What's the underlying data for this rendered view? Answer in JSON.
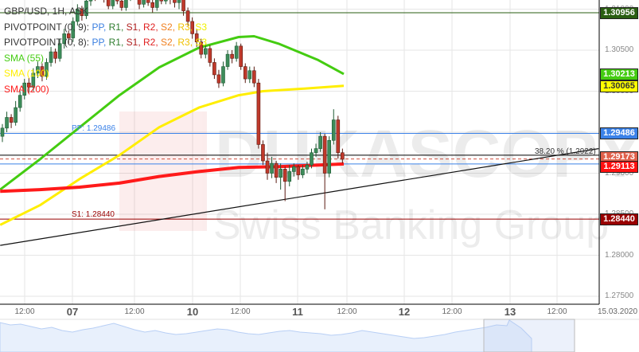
{
  "legend": {
    "symbol": "GBP/USD, 1H, ASK",
    "pivot1_prefix": "PIVOTPOINT (0, 9):",
    "pivot2_prefix": "PIVOTPOINT (0, 8):",
    "pivot_items": [
      "PP",
      "R1",
      "S1",
      "R2",
      "S2",
      "R3",
      "S3"
    ],
    "pivot_colors": [
      "#3a7fe0",
      "#2f7d2f",
      "#b22222",
      "#e02020",
      "#f08020",
      "#f0c000",
      "#f0f000"
    ],
    "sma55": "SMA (55)",
    "sma100": "SMA (100)",
    "sma200": "SMA (200)"
  },
  "line_labels": {
    "pp": "PP: 1.29486",
    "s1": "S1: 1.28440",
    "fib": "38.20 % (1.2922)"
  },
  "tags": [
    {
      "text": "1.30956",
      "bg": "#2a5e12",
      "fg": "#ffffff",
      "price": 1.30956
    },
    {
      "text": "1.30213",
      "bg": "#44cc11",
      "fg": "#ffffff",
      "price": 1.30213
    },
    {
      "text": "1.30065",
      "bg": "#ffff00",
      "fg": "#333333",
      "price": 1.30065
    },
    {
      "text": "1.29486",
      "bg": "#3b82e8",
      "fg": "#ffffff",
      "price": 1.29486
    },
    {
      "text": "1.29173",
      "bg": "#e0604a",
      "fg": "#ffffff",
      "price": 1.29173
    },
    {
      "text": "1.29113",
      "bg": "#ff1010",
      "fg": "#ffffff",
      "price": 1.29113
    },
    {
      "text": "1.28440",
      "bg": "#990000",
      "fg": "#ffffff",
      "price": 1.2844
    }
  ],
  "chart_data": {
    "type": "candlestick",
    "title": "GBP/USD, 1H, ASK",
    "ylim": [
      1.2737,
      1.3111
    ],
    "yticks": [
      "1.31000",
      "1.30500",
      "1.30000",
      "1.29500",
      "1.29000",
      "1.28500",
      "1.28000",
      "1.27500"
    ],
    "xticks": [
      {
        "label": "12:00",
        "day": false
      },
      {
        "label": "07",
        "day": true
      },
      {
        "label": "12:00",
        "day": false
      },
      {
        "label": "10",
        "day": true
      },
      {
        "label": "12:00",
        "day": false
      },
      {
        "label": "11",
        "day": true
      },
      {
        "label": "12:00",
        "day": false
      },
      {
        "label": "12",
        "day": true
      },
      {
        "label": "12:00",
        "day": false
      },
      {
        "label": "13",
        "day": true
      },
      {
        "label": "12:00",
        "day": false
      },
      {
        "label": "15.03.2020",
        "day": false
      }
    ],
    "candles": [
      [
        1.2945,
        1.296,
        1.2938,
        1.2955
      ],
      [
        1.2955,
        1.2975,
        1.295,
        1.2968
      ],
      [
        1.2968,
        1.2972,
        1.2955,
        1.2962
      ],
      [
        1.2962,
        1.2988,
        1.2958,
        1.298
      ],
      [
        1.298,
        1.3,
        1.2975,
        1.2995
      ],
      [
        1.2995,
        1.3015,
        1.299,
        1.301
      ],
      [
        1.301,
        1.3016,
        1.2998,
        1.3005
      ],
      [
        1.3005,
        1.3028,
        1.3,
        1.3022
      ],
      [
        1.3022,
        1.3036,
        1.3016,
        1.303
      ],
      [
        1.303,
        1.3034,
        1.3012,
        1.3018
      ],
      [
        1.3018,
        1.304,
        1.3014,
        1.3035
      ],
      [
        1.3035,
        1.3054,
        1.303,
        1.3048
      ],
      [
        1.3048,
        1.3052,
        1.3034,
        1.304
      ],
      [
        1.304,
        1.3064,
        1.3036,
        1.3058
      ],
      [
        1.3058,
        1.3076,
        1.3052,
        1.307
      ],
      [
        1.307,
        1.3074,
        1.3058,
        1.3065
      ],
      [
        1.3065,
        1.309,
        1.306,
        1.3085
      ],
      [
        1.3085,
        1.3106,
        1.308,
        1.31
      ],
      [
        1.31,
        1.3104,
        1.3086,
        1.3092
      ],
      [
        1.3092,
        1.3118,
        1.3088,
        1.311
      ],
      [
        1.311,
        1.313,
        1.3104,
        1.3125
      ],
      [
        1.3125,
        1.3128,
        1.311,
        1.3118
      ],
      [
        1.3118,
        1.3136,
        1.3112,
        1.313
      ],
      [
        1.313,
        1.3134,
        1.3108,
        1.3112
      ],
      [
        1.3112,
        1.312,
        1.31,
        1.3104
      ],
      [
        1.3104,
        1.3122,
        1.31,
        1.3118
      ],
      [
        1.3118,
        1.3126,
        1.3106,
        1.311
      ],
      [
        1.311,
        1.3116,
        1.3098,
        1.3102
      ],
      [
        1.3102,
        1.312,
        1.3098,
        1.3115
      ],
      [
        1.3115,
        1.313,
        1.311,
        1.3126
      ],
      [
        1.3126,
        1.313,
        1.3112,
        1.3116
      ],
      [
        1.3116,
        1.3122,
        1.31,
        1.3106
      ],
      [
        1.3106,
        1.3118,
        1.3102,
        1.3114
      ],
      [
        1.3114,
        1.3122,
        1.3104,
        1.3108
      ],
      [
        1.3108,
        1.3114,
        1.3096,
        1.3102
      ],
      [
        1.3102,
        1.312,
        1.3098,
        1.3116
      ],
      [
        1.3116,
        1.3124,
        1.3106,
        1.311
      ],
      [
        1.311,
        1.3126,
        1.3106,
        1.312
      ],
      [
        1.312,
        1.3124,
        1.3106,
        1.3112
      ],
      [
        1.3112,
        1.3118,
        1.3102,
        1.3108
      ],
      [
        1.3108,
        1.312,
        1.31,
        1.3112
      ],
      [
        1.3112,
        1.3114,
        1.3092,
        1.3098
      ],
      [
        1.3098,
        1.3102,
        1.308,
        1.3085
      ],
      [
        1.3085,
        1.309,
        1.3064,
        1.307
      ],
      [
        1.307,
        1.3076,
        1.3054,
        1.306
      ],
      [
        1.306,
        1.3064,
        1.304,
        1.3045
      ],
      [
        1.3045,
        1.3058,
        1.304,
        1.3052
      ],
      [
        1.3052,
        1.3056,
        1.303,
        1.3035
      ],
      [
        1.3035,
        1.304,
        1.3015,
        1.302
      ],
      [
        1.302,
        1.3026,
        1.3004,
        1.301
      ],
      [
        1.301,
        1.3036,
        1.3006,
        1.303
      ],
      [
        1.303,
        1.305,
        1.3026,
        1.3045
      ],
      [
        1.3045,
        1.305,
        1.3034,
        1.304
      ],
      [
        1.304,
        1.306,
        1.3036,
        1.3055
      ],
      [
        1.3055,
        1.3058,
        1.3026,
        1.303
      ],
      [
        1.303,
        1.3034,
        1.301,
        1.3015
      ],
      [
        1.3015,
        1.303,
        1.301,
        1.3025
      ],
      [
        1.3025,
        1.303,
        1.3005,
        1.301
      ],
      [
        1.301,
        1.3015,
        1.293,
        1.2935
      ],
      [
        1.2935,
        1.294,
        1.291,
        1.2915
      ],
      [
        1.2915,
        1.2925,
        1.2892,
        1.29
      ],
      [
        1.29,
        1.292,
        1.2894,
        1.2912
      ],
      [
        1.2912,
        1.2915,
        1.2888,
        1.2895
      ],
      [
        1.2895,
        1.2912,
        1.288,
        1.2905
      ],
      [
        1.2905,
        1.2908,
        1.2866,
        1.289
      ],
      [
        1.289,
        1.291,
        1.2884,
        1.2902
      ],
      [
        1.2902,
        1.2912,
        1.2896,
        1.2908
      ],
      [
        1.2908,
        1.291,
        1.2892,
        1.2898
      ],
      [
        1.2898,
        1.291,
        1.2894,
        1.2905
      ],
      [
        1.2905,
        1.2914,
        1.29,
        1.291
      ],
      [
        1.291,
        1.293,
        1.2906,
        1.2925
      ],
      [
        1.2925,
        1.2936,
        1.292,
        1.293
      ],
      [
        1.293,
        1.295,
        1.2926,
        1.2945
      ],
      [
        1.2945,
        1.2948,
        1.2856,
        1.29
      ],
      [
        1.29,
        1.2945,
        1.2895,
        1.294
      ],
      [
        1.294,
        1.2978,
        1.2935,
        1.2965
      ],
      [
        1.2965,
        1.297,
        1.2918,
        1.2925
      ],
      [
        1.2925,
        1.293,
        1.2912,
        1.2917
      ]
    ],
    "series": [
      {
        "name": "SMA (55)",
        "color": "#44cc11",
        "points": [
          [
            -0.5,
            1.288
          ],
          [
            8.5,
            1.2917
          ],
          [
            17.5,
            1.2956
          ],
          [
            26.5,
            1.2995
          ],
          [
            35.5,
            1.3029
          ],
          [
            44.5,
            1.3053
          ],
          [
            53.5,
            1.3066
          ],
          [
            57,
            1.3067
          ],
          [
            62.5,
            1.3058
          ],
          [
            71.5,
            1.3038
          ],
          [
            77.3,
            1.3021
          ]
        ]
      },
      {
        "name": "SMA (100)",
        "color": "#ffee00",
        "points": [
          [
            -0.5,
            1.2837
          ],
          [
            8.5,
            1.2861
          ],
          [
            17.5,
            1.2893
          ],
          [
            26.5,
            1.2922
          ],
          [
            35.5,
            1.2956
          ],
          [
            44.5,
            1.298
          ],
          [
            53.5,
            1.2995
          ],
          [
            59,
            1.3
          ],
          [
            68,
            1.3003
          ],
          [
            77.3,
            1.30065
          ]
        ]
      },
      {
        "name": "SMA (200)",
        "color": "#ff1a1a",
        "points": [
          [
            -0.5,
            1.2878
          ],
          [
            8.5,
            1.288
          ],
          [
            17.5,
            1.2883
          ],
          [
            26.5,
            1.2888
          ],
          [
            35.5,
            1.2896
          ],
          [
            44.5,
            1.2902
          ],
          [
            53.5,
            1.2907
          ],
          [
            62.5,
            1.2908
          ],
          [
            71.5,
            1.291
          ],
          [
            77.3,
            1.29113
          ]
        ]
      }
    ],
    "hlines": [
      {
        "name": "pivot-r-level",
        "price": 1.30956,
        "color": "#2a5e12",
        "dash": false
      },
      {
        "name": "pivot-pp",
        "price": 1.29486,
        "color": "#3b82e8",
        "dash": false
      },
      {
        "name": "fib-38-2",
        "price": 1.2922,
        "color": "#000000",
        "dash": false
      },
      {
        "name": "ask-price",
        "price": 1.29173,
        "color": "#d05040",
        "dash": true
      },
      {
        "name": "bid-price",
        "price": 1.29113,
        "color": "#3b82e8",
        "dash": false
      },
      {
        "name": "pivot-s1",
        "price": 1.2844,
        "color": "#990000",
        "dash": false
      }
    ],
    "trendline": {
      "from": [
        -0.5,
        1.2812
      ],
      "to": [
        135,
        1.293
      ]
    }
  },
  "watermark": {
    "brand": "DUKASCOPY",
    "tagline": "Swiss Banking Group"
  }
}
